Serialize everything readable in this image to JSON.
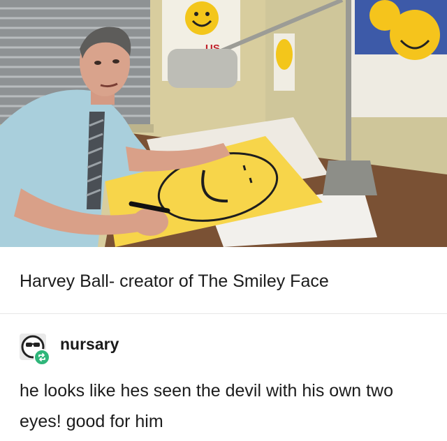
{
  "photo": {
    "image_name": "harvey-ball-drawing-smiley-photo",
    "sign_text": "US"
  },
  "caption": "Harvey Ball- creator of The Smiley Face",
  "reblog": {
    "username": "nursary",
    "avatar_icon": "sunglasses-face-icon",
    "badge_icon": "reblog-icon",
    "badge_color": "#2fb67a"
  },
  "comment": "he looks like hes seen the devil with his own two eyes! good for him"
}
